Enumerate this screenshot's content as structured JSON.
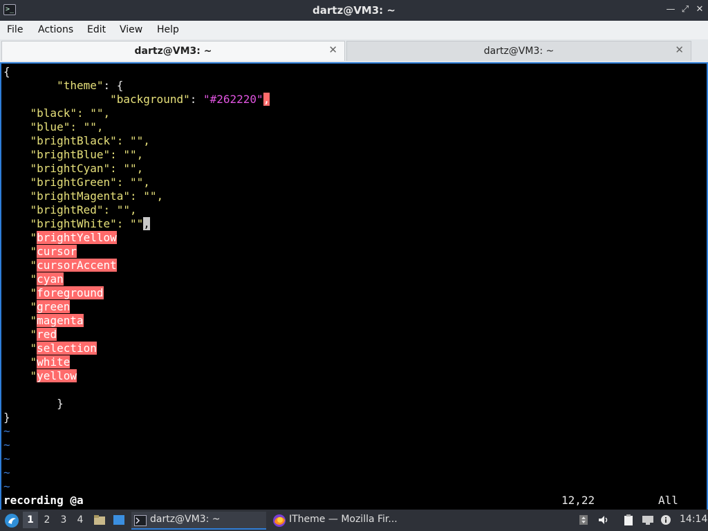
{
  "window": {
    "title": "dartz@VM3: ~"
  },
  "menu": [
    "File",
    "Actions",
    "Edit",
    "View",
    "Help"
  ],
  "tabs": [
    {
      "label": "dartz@VM3: ~"
    },
    {
      "label": "dartz@VM3: ~"
    }
  ],
  "editor": {
    "lines": {
      "l1": "{",
      "theme_key": "\"theme\"",
      "theme_rest": ": {",
      "bg_key": "\"background\"",
      "bg_colon": ": ",
      "bg_value": "\"#262220\"",
      "bg_comma": ",",
      "black": "\"black\": \"\",",
      "blue": "\"blue\": \"\",",
      "brightBlack": "\"brightBlack\": \"\",",
      "brightBlue": "\"brightBlue\": \"\",",
      "brightCyan": "\"brightCyan\": \"\",",
      "brightGreen": "\"brightGreen\": \"\",",
      "brightMagenta": "\"brightMagenta\": \"\",",
      "brightRed": "\"brightRed\": \"\",",
      "brightWhite": "\"brightWhite\": \"\"",
      "brightWhite_comma": ",",
      "close_inner": "}",
      "close_outer": "}"
    },
    "highlighted": [
      "brightYellow",
      "cursor",
      "cursorAccent",
      "cyan",
      "foreground",
      "green",
      "magenta",
      "red",
      "selection",
      "white",
      "yellow"
    ],
    "quote": "\"",
    "tilde": "~",
    "status_left": "recording @a",
    "status_pos": "12,22",
    "status_scroll": "All"
  },
  "taskbar": {
    "workspaces": [
      "1",
      "2",
      "3",
      "4"
    ],
    "terminal_task": "dartz@VM3: ~",
    "firefox_task": "ITheme — Mozilla Fir...",
    "clock": "14:14"
  },
  "colors": {
    "accent": "#2f7ed8",
    "highlight": "#ff6b6b",
    "string": "#e6e07a",
    "value": "#e054e0"
  }
}
